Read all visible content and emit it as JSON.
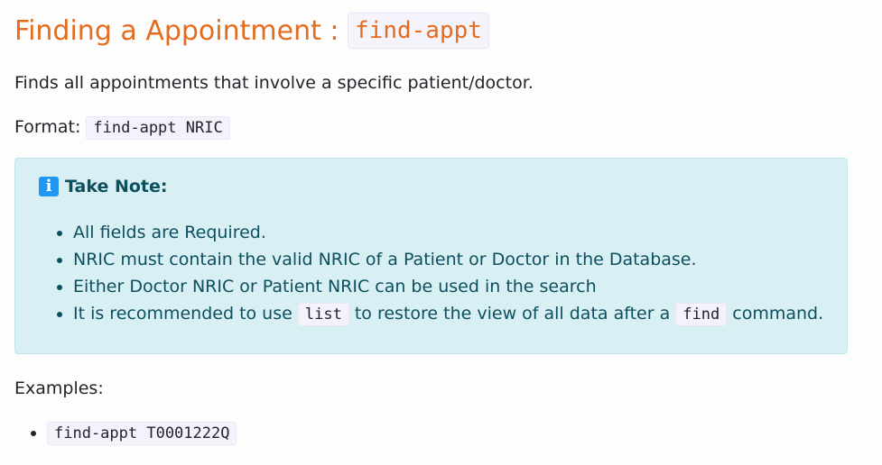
{
  "heading": {
    "text": "Finding a Appointment : ",
    "code": "find-appt"
  },
  "description": "Finds all appointments that involve a specific patient/doctor.",
  "format": {
    "label": "Format: ",
    "code": "find-appt NRIC"
  },
  "note": {
    "icon": "info-icon",
    "title": "Take Note:",
    "items": [
      {
        "text": "All fields are Required."
      },
      {
        "text": "NRIC must contain the valid NRIC of a Patient or Doctor in the Database."
      },
      {
        "text": "Either Doctor NRIC or Patient NRIC can be used in the search"
      },
      {
        "part1": "It is recommended to use ",
        "code1": "list",
        "part2": " to restore the view of all data after a ",
        "code2": "find",
        "part3": " command."
      }
    ]
  },
  "examples": {
    "label": "Examples:",
    "items": [
      "find-appt T0001222Q"
    ]
  },
  "colors": {
    "heading": "#e46c1f",
    "note_background": "#d8eff3",
    "note_text": "#0c4f5f",
    "info_icon": "#2196f3"
  }
}
